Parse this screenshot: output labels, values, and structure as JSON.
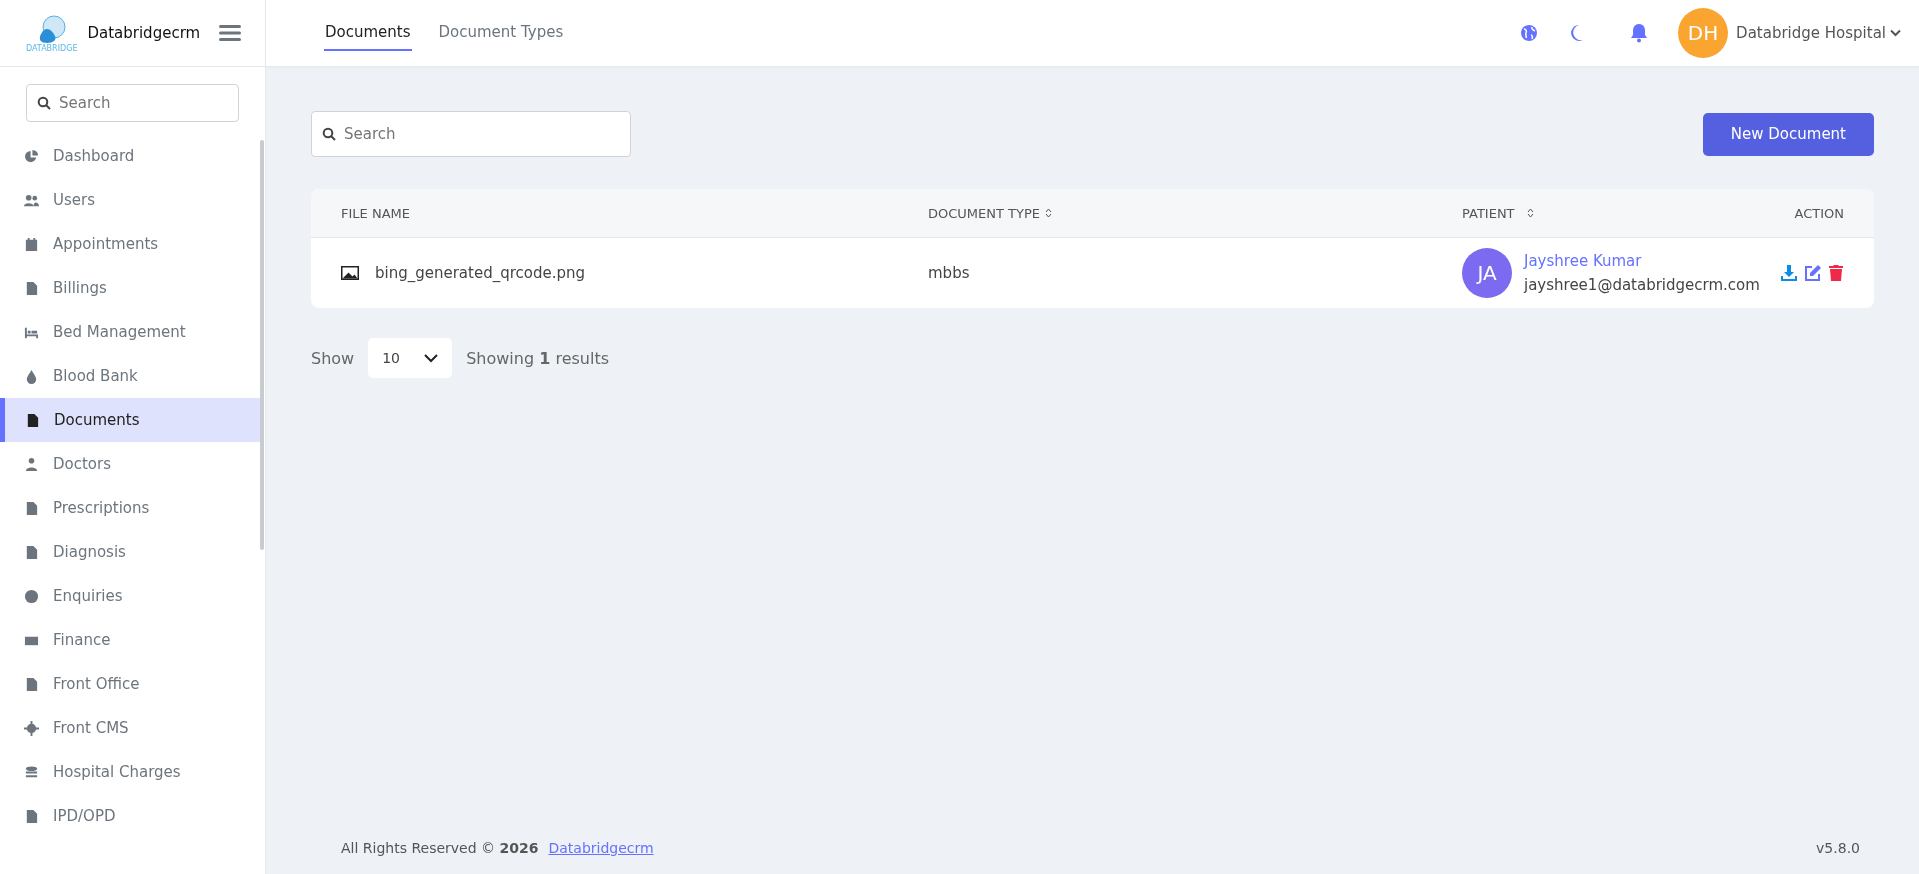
{
  "brand": {
    "logo_text": "DATABRIDGE",
    "name": "Databridgecrm"
  },
  "sidebar": {
    "search": {
      "placeholder": "Search"
    },
    "items": [
      {
        "label": "Dashboard",
        "selected": false
      },
      {
        "label": "Users",
        "selected": false
      },
      {
        "label": "Appointments",
        "selected": false
      },
      {
        "label": "Billings",
        "selected": false
      },
      {
        "label": "Bed Management",
        "selected": false
      },
      {
        "label": "Blood Bank",
        "selected": false
      },
      {
        "label": "Documents",
        "selected": true
      },
      {
        "label": "Doctors",
        "selected": false
      },
      {
        "label": "Prescriptions",
        "selected": false
      },
      {
        "label": "Diagnosis",
        "selected": false
      },
      {
        "label": "Enquiries",
        "selected": false
      },
      {
        "label": "Finance",
        "selected": false
      },
      {
        "label": "Front Office",
        "selected": false
      },
      {
        "label": "Front CMS",
        "selected": false
      },
      {
        "label": "Hospital Charges",
        "selected": false
      },
      {
        "label": "IPD/OPD",
        "selected": false
      }
    ]
  },
  "tabs": [
    {
      "label": "Documents",
      "selected": true
    },
    {
      "label": "Document Types",
      "selected": false
    }
  ],
  "user": {
    "initials": "DH",
    "name": "Databridge Hospital"
  },
  "search": {
    "placeholder": "Search"
  },
  "new_button": "New Document",
  "table": {
    "columns": [
      {
        "label": "FILE NAME",
        "sortable": false
      },
      {
        "label": "DOCUMENT TYPE",
        "sortable": true
      },
      {
        "label": "PATIENT",
        "sortable": true
      },
      {
        "label": "ACTION",
        "sortable": false
      }
    ],
    "rows": [
      {
        "file_name": "bing_generated_qrcode.png",
        "document_type": "mbbs",
        "patient_initials": "JA",
        "patient_name": "Jayshree Kumar",
        "patient_email": "jayshree1@databridgecrm.com"
      }
    ]
  },
  "pagination": {
    "show_label": "Show",
    "page_size": "10",
    "summary": "Showing **1** results"
  },
  "footer": {
    "copyright": "All Rights Reserved © **2026**",
    "link": "Databridgecrm",
    "version": "v5.8.0"
  }
}
